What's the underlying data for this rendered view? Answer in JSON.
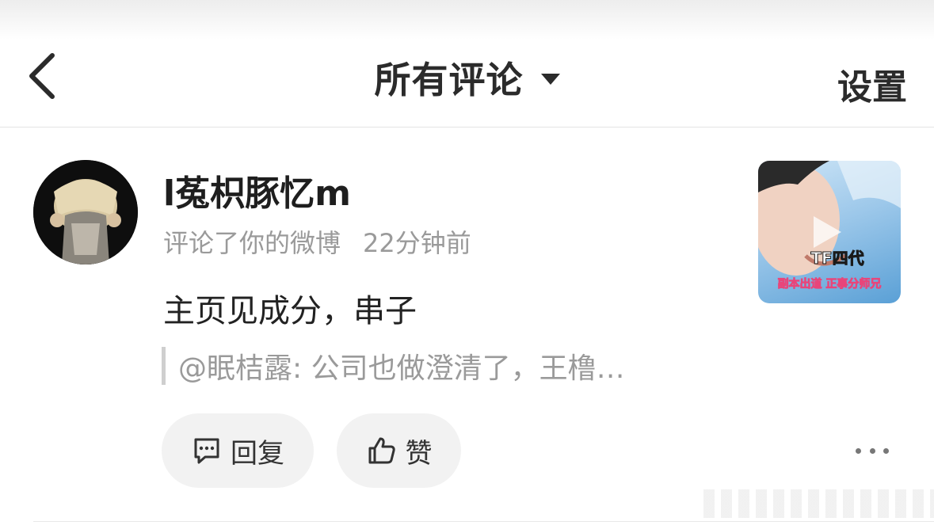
{
  "header": {
    "title": "所有评论",
    "settings_label": "设置"
  },
  "comment": {
    "username": "l菟枳豚忆m",
    "action": "评论了你的微博",
    "time": "22分钟前",
    "text": "主页见成分，串子",
    "quote": "@眠桔露: 公司也做澄清了，王橹…",
    "thumbnail_text_1": "TF四代",
    "thumbnail_text_2": "副本出道 正事分师兄"
  },
  "actions": {
    "reply_label": "回复",
    "like_label": "赞"
  },
  "icons": {
    "back": "chevron-left-icon",
    "dropdown": "caret-down-icon",
    "reply": "comment-bubble-icon",
    "like": "thumbs-up-icon",
    "more": "more-dots-icon"
  },
  "colors": {
    "text_primary": "#222222",
    "text_secondary": "#9a9a9a",
    "pill_bg": "#f2f2f2",
    "thumb_label_pink": "#e8457a"
  }
}
